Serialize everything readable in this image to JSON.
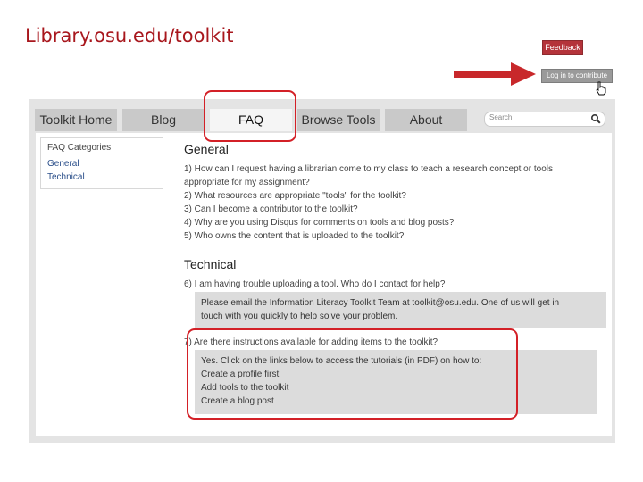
{
  "slide": {
    "title": "Library.osu.edu/toolkit"
  },
  "header": {
    "feedback_label": "Feedback",
    "login_label": "Log in to contribute"
  },
  "nav": {
    "tabs": [
      "Toolkit Home",
      "Blog",
      "FAQ",
      "Browse Tools",
      "About"
    ],
    "active": "FAQ"
  },
  "search": {
    "placeholder": "Search"
  },
  "sidebar": {
    "title": "FAQ Categories",
    "items": [
      "General",
      "Technical"
    ]
  },
  "general": {
    "title": "General",
    "questions": [
      "1) How can I request having a librarian come to my class to teach a research concept or tools",
      "appropriate for my assignment?",
      "2) What resources are appropriate \"tools\" for the toolkit?",
      "3) Can I become a contributor to the toolkit?",
      "4) Why are you using Disqus for comments on tools and blog posts?",
      "5) Who owns the content that is uploaded to the toolkit?"
    ]
  },
  "technical": {
    "title": "Technical",
    "q6": "6) I am having trouble uploading a tool. Who do I contact for help?",
    "a6": [
      "Please email the Information Literacy Toolkit Team at toolkit@osu.edu.  One of us will get in",
      "touch with you quickly to help solve your problem."
    ],
    "q7": "7) Are there instructions available for adding items to the toolkit?",
    "a7_intro": "Yes. Click on the links below to access the tutorials (in PDF) on how to:",
    "a7_links": [
      "Create a profile first",
      "Add tools to the toolkit",
      "Create a blog post"
    ]
  },
  "colors": {
    "highlight": "#d32027",
    "feedback": "#b4333a",
    "title": "#a8171d",
    "link": "#2b4f8a"
  }
}
